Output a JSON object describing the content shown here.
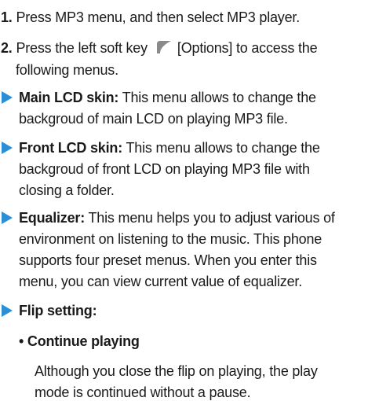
{
  "steps": [
    {
      "number": "1.",
      "text": "Press MP3 menu, and then select MP3 player."
    },
    {
      "number": "2.",
      "text_before_icon": "Press the left soft key",
      "icon": "left-soft-key-icon",
      "text_after_icon": "[Options] to access the",
      "text_line2": "following menus."
    }
  ],
  "menu_items": [
    {
      "title": "Main LCD skin:",
      "line1": "This menu allows to change the",
      "line2": "backgroud of main LCD on playing MP3 file."
    },
    {
      "title": "Front LCD skin:",
      "line1": "This menu allows to change the",
      "line2": "backgroud of front LCD on playing MP3 file with",
      "line3": "closing a folder."
    },
    {
      "title": "Equalizer:",
      "line1": "This menu helps you to adjust various of",
      "line2": "environment on listening to the music. This phone",
      "line3": "supports four preset menus. When you enter this",
      "line4": "menu, you can view current value of equalizer."
    },
    {
      "title": "Flip setting:"
    }
  ],
  "sub_item": {
    "bullet": "•",
    "title": "Continue playing",
    "line1": "Although you close the flip on playing, the play",
    "line2": "mode is continued without a pause."
  },
  "colors": {
    "accent_arrow": "#2a8fd6",
    "text": "#1a1a1a"
  }
}
